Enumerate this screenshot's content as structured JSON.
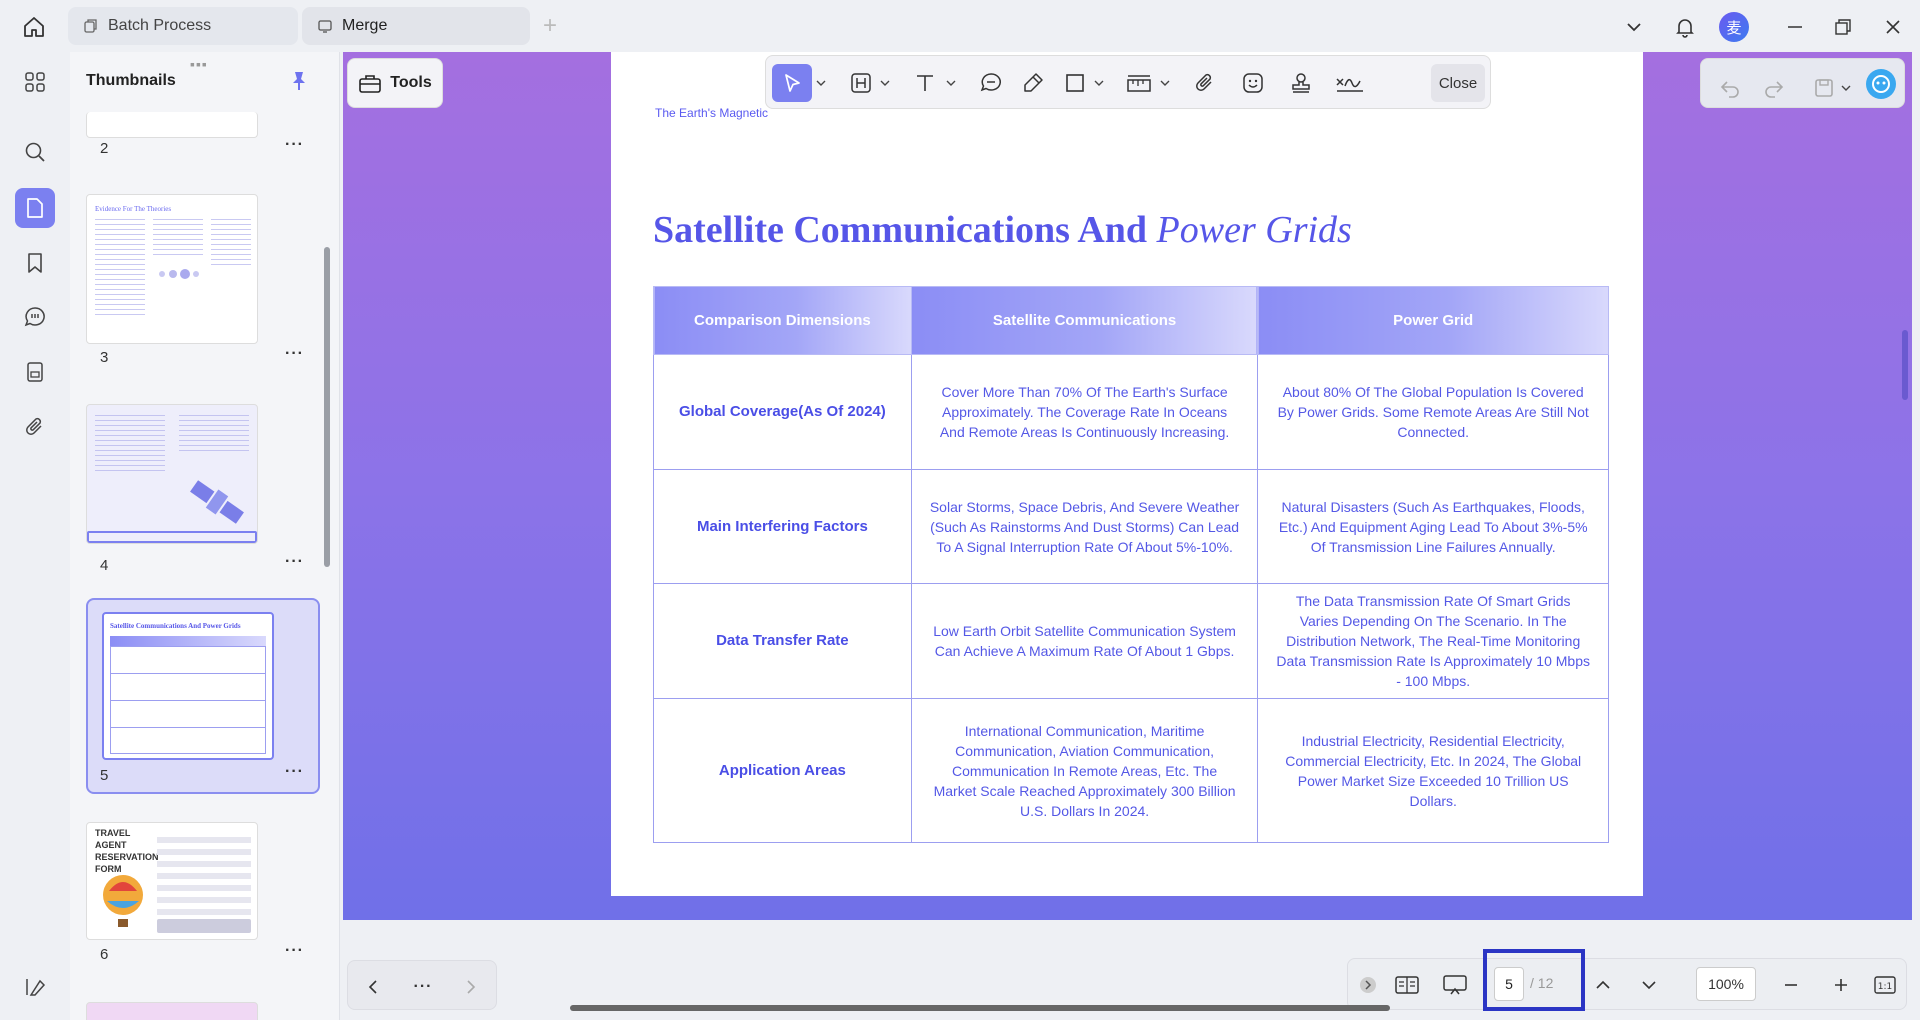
{
  "tabs": [
    {
      "label": "Batch Process"
    },
    {
      "label": "Merge"
    }
  ],
  "avatar_char": "麦",
  "sidebar": {
    "title": "Thumbnails"
  },
  "thumbnails": [
    {
      "num": "2"
    },
    {
      "num": "3"
    },
    {
      "num": "4"
    },
    {
      "num": "5"
    },
    {
      "num": "6"
    }
  ],
  "thumb_labels": {
    "t3_title": "Evidence For The Theories",
    "t5_title": "Satellite Communications And Power Grids",
    "t6_title": "TRAVEL AGENT RESERVATION FORM"
  },
  "toolbar": {
    "tools_label": "Tools",
    "close_label": "Close"
  },
  "document": {
    "snippet": "The Earth's Magnetic",
    "title_bold": "Satellite Communications And ",
    "title_italic": "Power Grids",
    "headers": [
      "Comparison Dimensions",
      "Satellite Communications",
      "Power Grid"
    ],
    "rows": [
      {
        "dimension": "Global Coverage(As Of 2024)",
        "satellite": "Cover More Than 70% Of The Earth's Surface Approximately. The Coverage Rate In Oceans And Remote Areas Is Continuously Increasing.",
        "power": "About 80% Of The Global Population Is Covered By Power Grids. Some Remote Areas Are Still Not Connected."
      },
      {
        "dimension": "Main Interfering Factors",
        "satellite": "Solar Storms, Space Debris, And Severe Weather (Such As Rainstorms And Dust Storms) Can Lead To A Signal Interruption Rate Of About 5%-10%.",
        "power": "Natural Disasters (Such As Earthquakes, Floods, Etc.) And Equipment Aging Lead To About 3%-5% Of Transmission Line Failures Annually."
      },
      {
        "dimension": "Data Transfer Rate",
        "satellite": "Low Earth Orbit Satellite Communication System Can Achieve A Maximum Rate Of About 1 Gbps.",
        "power": "The Data Transmission Rate Of Smart Grids Varies Depending On The Scenario. In The Distribution Network, The Real-Time Monitoring Data Transmission Rate Is Approximately 10 Mbps - 100 Mbps."
      },
      {
        "dimension": "Application Areas",
        "satellite": "International Communication, Maritime Communication, Aviation Communication, Communication In Remote Areas, Etc. The Market Scale Reached Approximately 300 Billion U.S. Dollars In 2024.",
        "power": "Industrial Electricity, Residential Electricity, Commercial Electricity, Etc. In 2024, The Global Power Market Size Exceeded 10 Trillion US Dollars."
      }
    ]
  },
  "pagination": {
    "current": "5",
    "total": "/ 12",
    "zoom": "100%"
  },
  "colors": {
    "accent": "#7b80f0",
    "doc_text": "#5458e6",
    "bg_top": "#a46fe0",
    "bg_bottom": "#7070e8"
  }
}
